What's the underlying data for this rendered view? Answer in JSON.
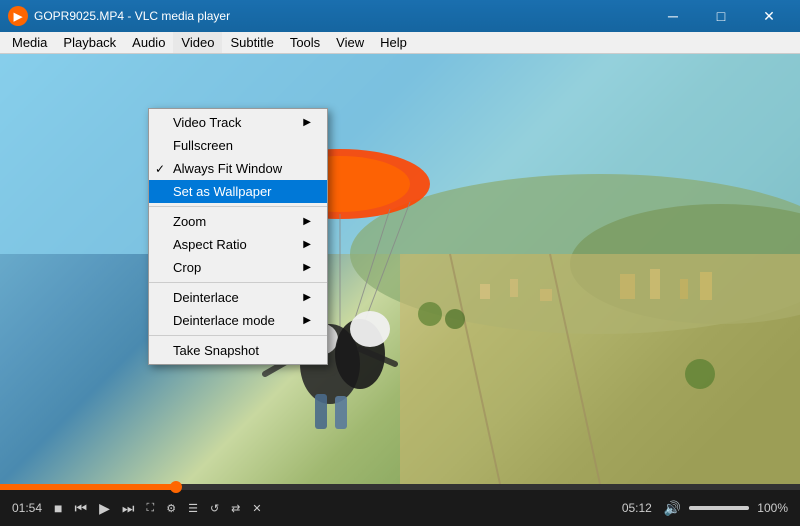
{
  "titlebar": {
    "title": "GOPR9025.MP4 - VLC media player",
    "icon": "▶",
    "min_btn": "─",
    "max_btn": "□",
    "close_btn": "✕"
  },
  "menubar": {
    "items": [
      "Media",
      "Playback",
      "Audio",
      "Video",
      "Subtitle",
      "Tools",
      "View",
      "Help"
    ]
  },
  "video_menu": {
    "items": [
      {
        "label": "Video Track",
        "has_arrow": true,
        "checked": false,
        "separator_after": false
      },
      {
        "label": "Fullscreen",
        "has_arrow": false,
        "checked": false,
        "separator_after": false
      },
      {
        "label": "Always Fit Window",
        "has_arrow": false,
        "checked": true,
        "separator_after": false
      },
      {
        "label": "Set as Wallpaper",
        "has_arrow": false,
        "checked": false,
        "separator_after": true,
        "highlighted": true
      },
      {
        "label": "Zoom",
        "has_arrow": true,
        "checked": false,
        "separator_after": false
      },
      {
        "label": "Aspect Ratio",
        "has_arrow": true,
        "checked": false,
        "separator_after": false
      },
      {
        "label": "Crop",
        "has_arrow": true,
        "checked": false,
        "separator_after": true
      },
      {
        "label": "Deinterlace",
        "has_arrow": true,
        "checked": false,
        "separator_after": false
      },
      {
        "label": "Deinterlace mode",
        "has_arrow": true,
        "checked": false,
        "separator_after": true
      },
      {
        "label": "Take Snapshot",
        "has_arrow": false,
        "checked": false,
        "separator_after": false
      }
    ]
  },
  "controls": {
    "time_current": "01:54",
    "time_total": "05:12",
    "progress_pct": 22,
    "volume_pct": 100,
    "volume_label": "100%"
  }
}
